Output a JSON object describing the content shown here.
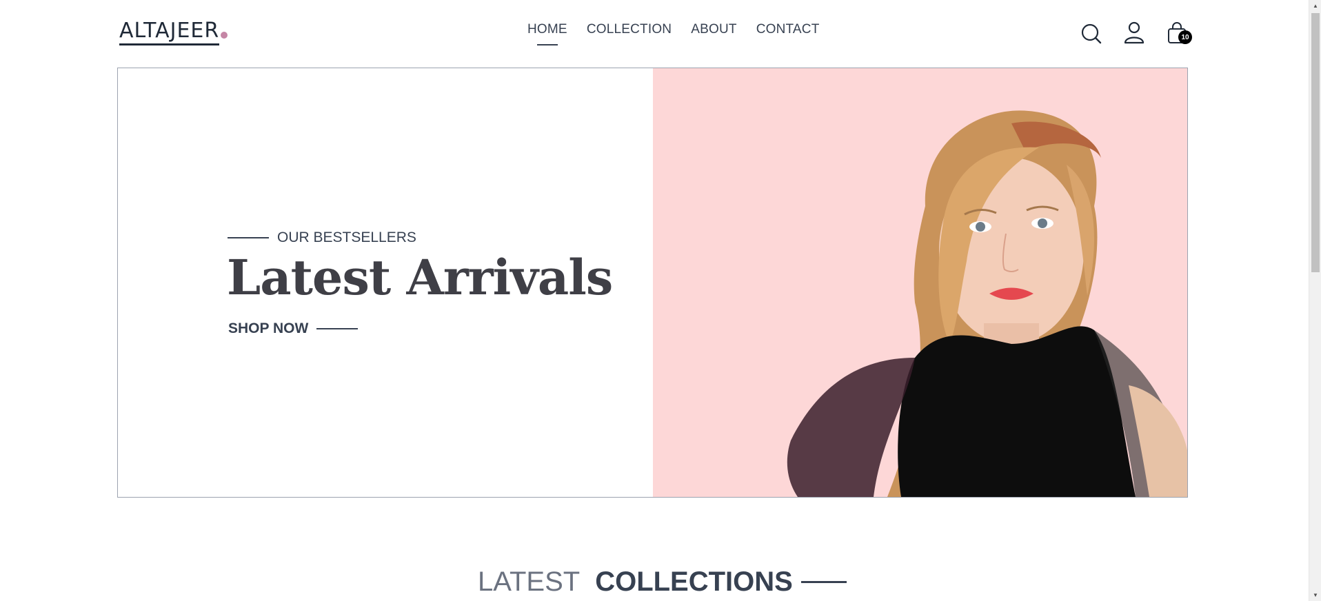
{
  "header": {
    "logo": "ALTAJEER",
    "nav": [
      {
        "label": "HOME",
        "active": true
      },
      {
        "label": "COLLECTION",
        "active": false
      },
      {
        "label": "ABOUT",
        "active": false
      },
      {
        "label": "CONTACT",
        "active": false
      }
    ],
    "cart_count": "10",
    "icons": [
      "search-icon",
      "profile-icon",
      "cart-icon"
    ]
  },
  "hero": {
    "eyebrow": "OUR BESTSELLERS",
    "title": "Latest Arrivals",
    "cta": "SHOP NOW",
    "image_bg": "#fdd7d7"
  },
  "section": {
    "title_light": "LATEST",
    "title_bold": "COLLECTIONS"
  },
  "colors": {
    "text": "#374151",
    "accent": "#c586a5",
    "hero_bg": "#fdd7d7"
  }
}
